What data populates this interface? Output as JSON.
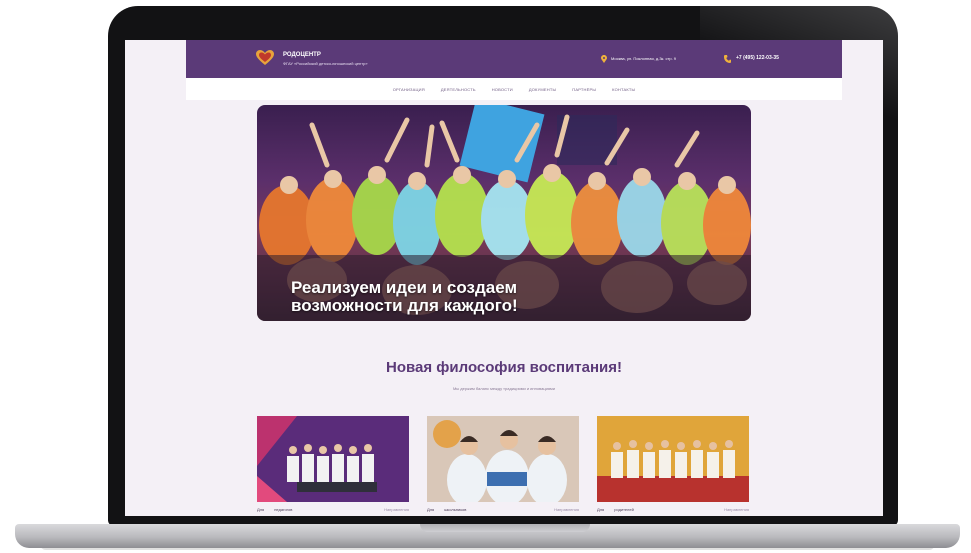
{
  "site": {
    "brand_name": "РОДОЦЕНТР",
    "brand_subtitle": "ФГАУ «Российский детско-юношеский центр»",
    "address": "Москва, ул. Поклонная, д.3к. стр. 9",
    "phone": "+7 (495) 122-03-35"
  },
  "nav": {
    "items": [
      {
        "label": "ОРГАНИЗАЦИЯ"
      },
      {
        "label": "ДЕЯТЕЛЬНОСТЬ"
      },
      {
        "label": "НОВОСТИ"
      },
      {
        "label": "ДОКУМЕНТЫ"
      },
      {
        "label": "ПАРТНЁРЫ"
      },
      {
        "label": "КОНТАКТЫ"
      }
    ]
  },
  "hero": {
    "caption_line1": "Реализуем идеи и создаем",
    "caption_line2": "возможности для каждого!"
  },
  "section": {
    "title": "Новая философия воспитания!",
    "subtitle": "Мы держим баланс между традициями и инновациями"
  },
  "cards": [
    {
      "word1": "Для",
      "word2": "педагогов",
      "tag": "Направления"
    },
    {
      "word1": "Для",
      "word2": "школьников",
      "tag": "Направления"
    },
    {
      "word1": "Для",
      "word2": "родителей",
      "tag": "Направления"
    }
  ],
  "colors": {
    "brand_purple": "#5b3a78",
    "page_bg": "#f4f0f6",
    "laptop_frame": "#121214"
  }
}
